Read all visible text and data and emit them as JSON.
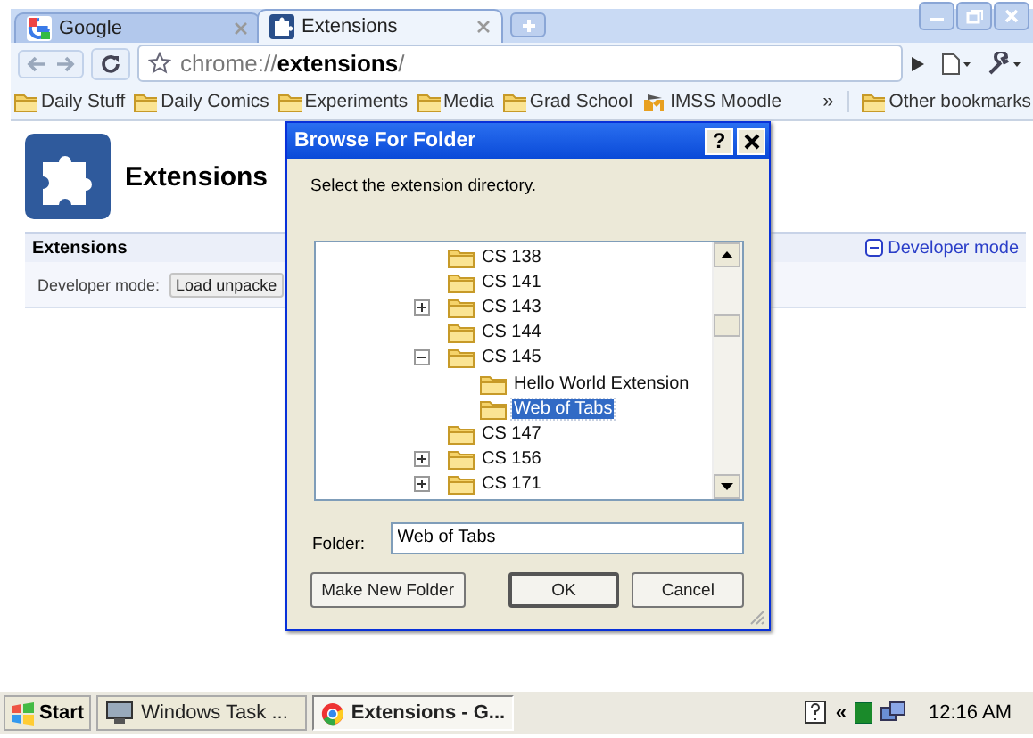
{
  "browser": {
    "tabs": [
      {
        "title": "Google",
        "selected": false
      },
      {
        "title": "Extensions",
        "selected": true
      }
    ],
    "address": "chrome://**extensions**/",
    "bookmarks": [
      {
        "label": "Daily Stuff",
        "kind": "folder"
      },
      {
        "label": "Daily Comics",
        "kind": "folder"
      },
      {
        "label": "Experiments",
        "kind": "folder"
      },
      {
        "label": "Media",
        "kind": "folder"
      },
      {
        "label": "Grad School",
        "kind": "folder"
      },
      {
        "label": "IMSS Moodle",
        "kind": "site"
      }
    ],
    "bookmarks_overflow": "»",
    "other_bookmarks": "Other bookmarks"
  },
  "page": {
    "title": "Extensions",
    "section": "Extensions",
    "developer_link": "Developer mode",
    "developer_label": "Developer mode:",
    "load_button": "Load unpacke"
  },
  "dialog": {
    "title": "Browse For Folder",
    "help": "?",
    "prompt": "Select the extension directory.",
    "tree": [
      {
        "label": "CS 138",
        "kind": "leaf",
        "selected": false
      },
      {
        "label": "CS 141",
        "kind": "leaf",
        "selected": false
      },
      {
        "label": "CS 143",
        "kind": "collapsed",
        "selected": false
      },
      {
        "label": "CS 144",
        "kind": "leaf",
        "selected": false
      },
      {
        "label": "CS 145",
        "kind": "expanded",
        "selected": false,
        "children": [
          {
            "label": "Hello World Extension",
            "kind": "leaf",
            "selected": false
          },
          {
            "label": "Web of Tabs",
            "kind": "leaf",
            "selected": true
          }
        ]
      },
      {
        "label": "CS 147",
        "kind": "leaf",
        "selected": false
      },
      {
        "label": "CS 156",
        "kind": "collapsed",
        "selected": false
      },
      {
        "label": "CS 171",
        "kind": "collapsed",
        "selected": false
      }
    ],
    "folder_label": "Folder:",
    "folder_value": "Web of Tabs",
    "buttons": [
      {
        "label": "Make New Folder",
        "default": false
      },
      {
        "label": "OK",
        "default": true
      },
      {
        "label": "Cancel",
        "default": false
      }
    ]
  },
  "taskbar": {
    "start": "Start",
    "tasks": [
      {
        "label": "Windows Task ...",
        "kind": "monitor",
        "selected": false
      },
      {
        "label": "Extensions - G...",
        "kind": "chrome",
        "selected": true
      }
    ],
    "tray_expand": "«",
    "clock": "12:16 AM"
  }
}
